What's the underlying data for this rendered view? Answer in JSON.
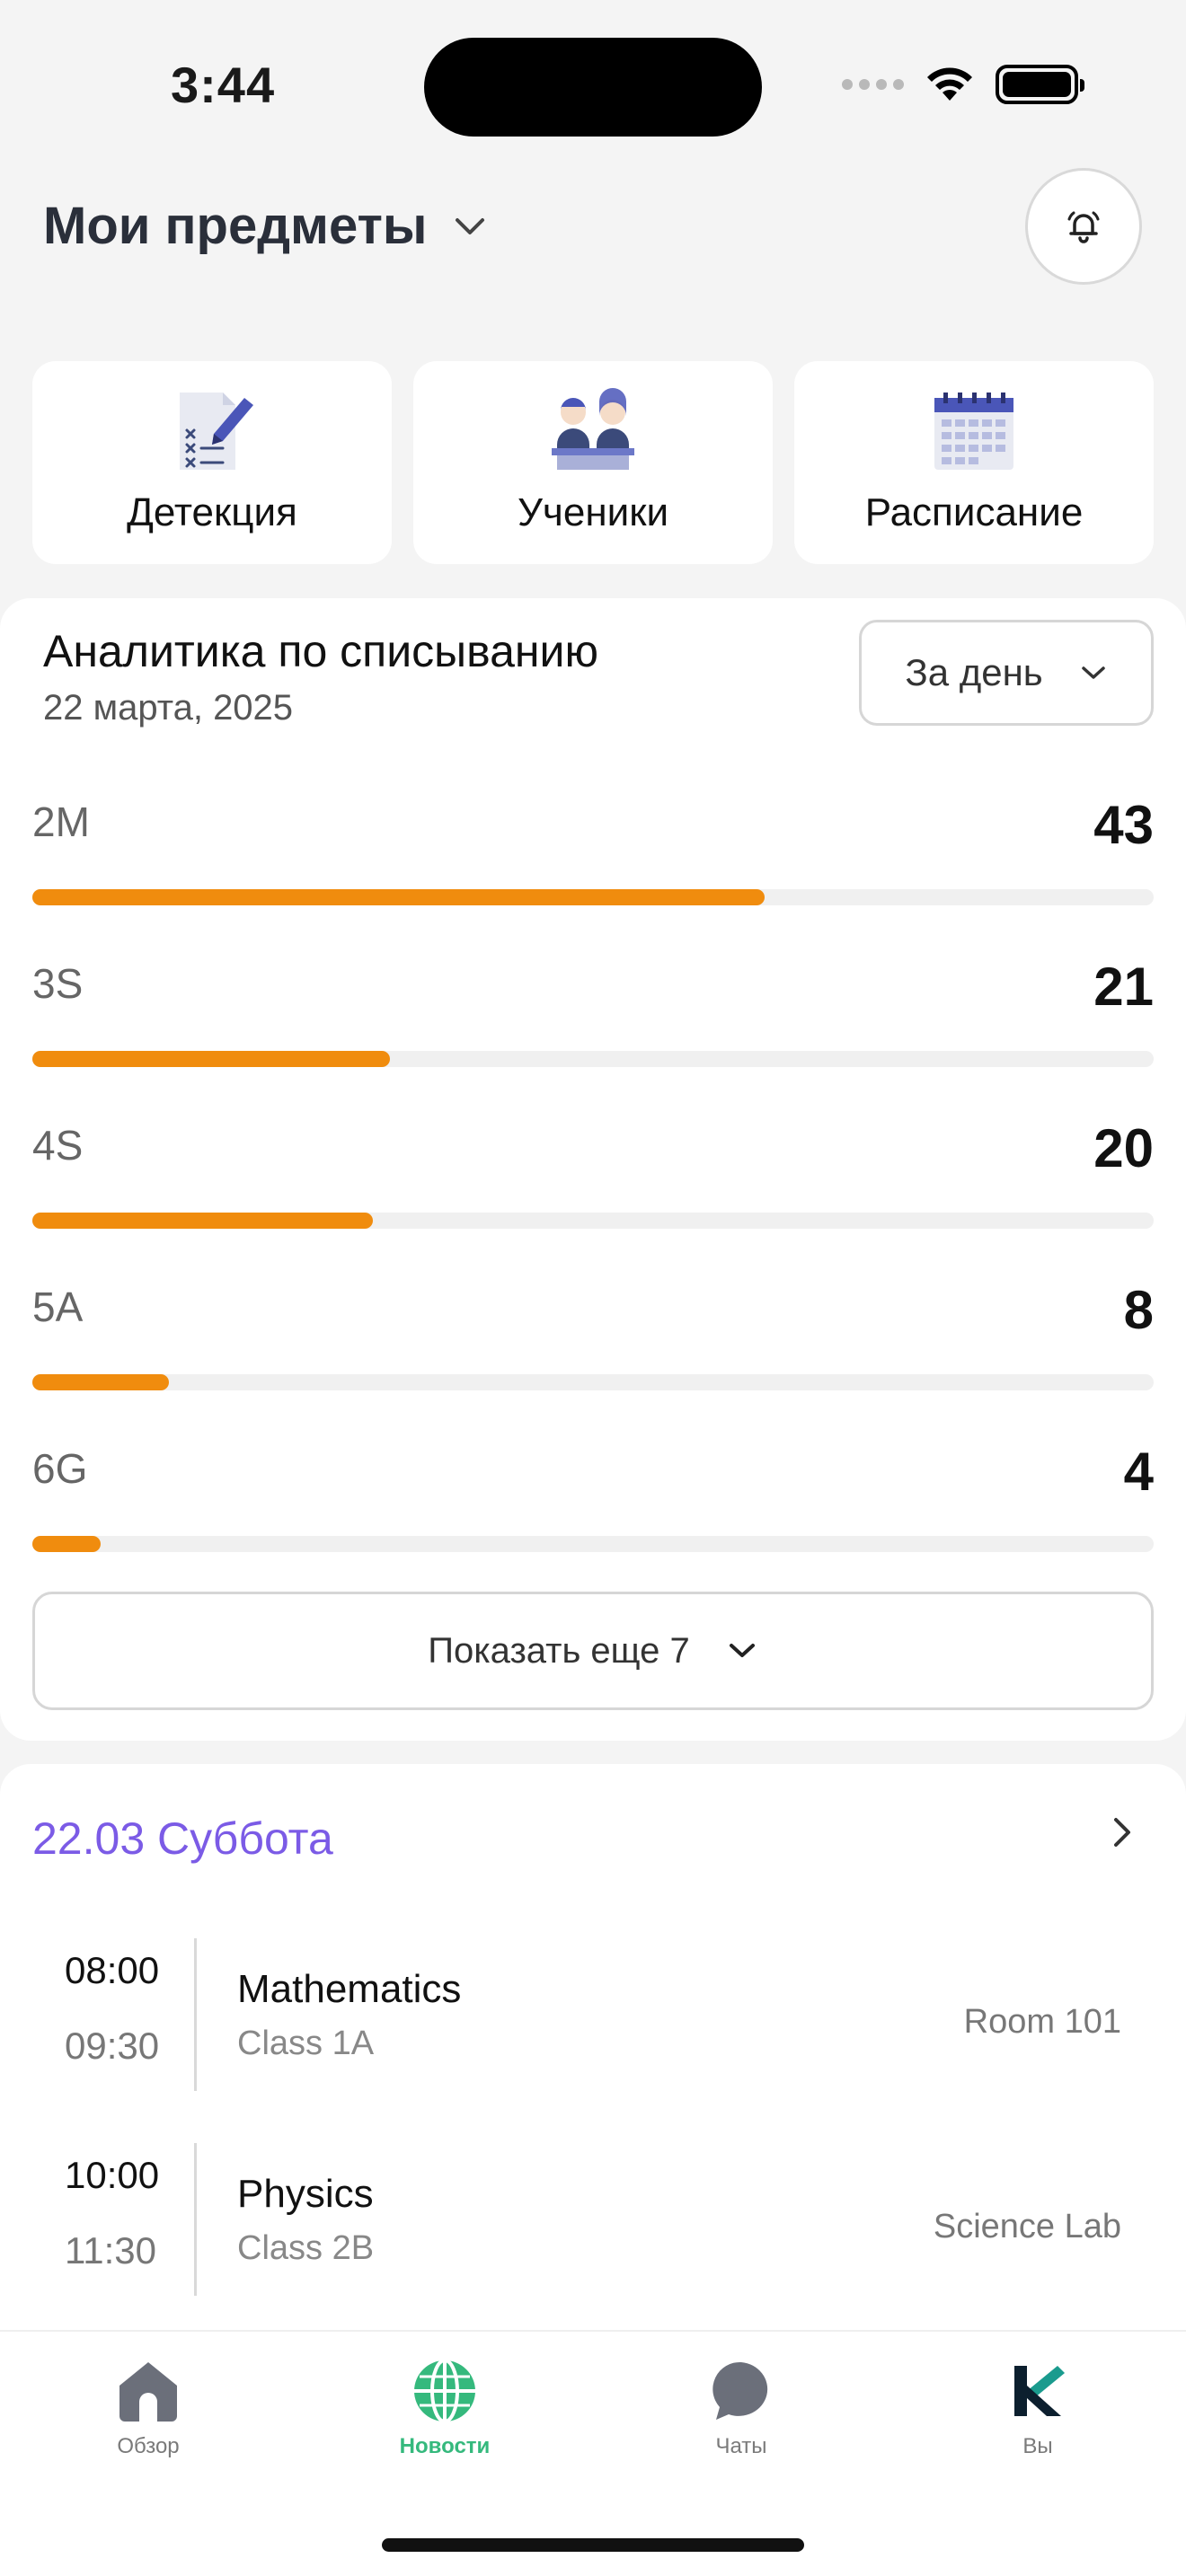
{
  "status_bar": {
    "time": "3:44"
  },
  "header": {
    "title": "Мои предметы"
  },
  "quick_actions": [
    {
      "label": "Детекция",
      "icon": "checklist-pen-icon"
    },
    {
      "label": "Ученики",
      "icon": "students-icon"
    },
    {
      "label": "Расписание",
      "icon": "calendar-icon"
    }
  ],
  "analytics": {
    "title": "Аналитика по списыванию",
    "date": "22 марта, 2025",
    "period": "За день",
    "show_more": "Показать еще 7",
    "accent_color": "#f08c0e",
    "rows": [
      {
        "label": "2M",
        "value": "43",
        "fraction": 0.653
      },
      {
        "label": "3S",
        "value": "21",
        "fraction": 0.319
      },
      {
        "label": "4S",
        "value": "20",
        "fraction": 0.304
      },
      {
        "label": "5A",
        "value": "8",
        "fraction": 0.122
      },
      {
        "label": "6G",
        "value": "4",
        "fraction": 0.061
      }
    ]
  },
  "schedule": {
    "date_label": "22.03 Суббота",
    "date_color": "#7b5be6",
    "lessons": [
      {
        "start": "08:00",
        "end": "09:30",
        "subject": "Mathematics",
        "class": "Class 1A",
        "room": "Room 101"
      },
      {
        "start": "10:00",
        "end": "11:30",
        "subject": "Physics",
        "class": "Class 2B",
        "room": "Science Lab"
      }
    ]
  },
  "tabbar": {
    "active_color": "#35b97d",
    "items": [
      {
        "label": "Обзор",
        "icon": "home-icon"
      },
      {
        "label": "Новости",
        "icon": "globe-icon"
      },
      {
        "label": "Чаты",
        "icon": "chat-bubble-icon"
      },
      {
        "label": "Вы",
        "icon": "profile-logo-icon"
      }
    ]
  }
}
